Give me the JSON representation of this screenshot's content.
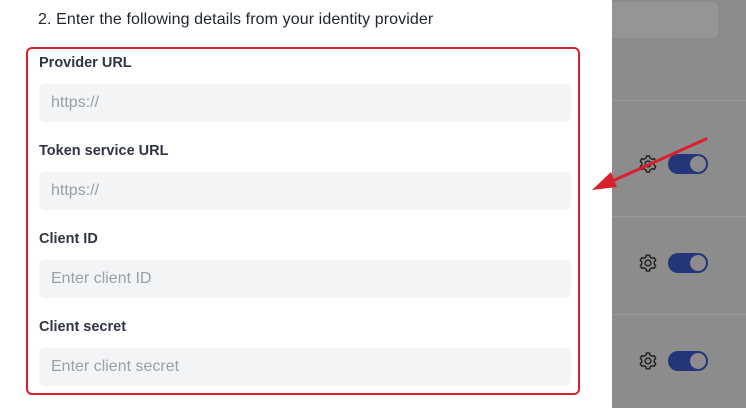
{
  "form": {
    "step_title": "2. Enter the following details from your identity provider",
    "fields": [
      {
        "label": "Provider URL",
        "value": "",
        "placeholder": "https://"
      },
      {
        "label": "Token service URL",
        "value": "",
        "placeholder": "https://"
      },
      {
        "label": "Client ID",
        "value": "",
        "placeholder": "Enter client ID"
      },
      {
        "label": "Client secret",
        "value": "",
        "placeholder": "Enter client secret"
      }
    ]
  },
  "backdrop": {
    "rows": [
      {
        "icon": "gear-icon",
        "toggle": "on"
      },
      {
        "icon": "gear-icon",
        "toggle": "on"
      },
      {
        "icon": "gear-icon",
        "toggle": "on"
      }
    ]
  },
  "annotation": {
    "highlight_color": "#d9202e",
    "arrow_color": "#d9202e"
  },
  "colors": {
    "backdrop": "#8c8c8c",
    "toggle_on": "#24357a",
    "input_bg": "#f3f4f6"
  }
}
